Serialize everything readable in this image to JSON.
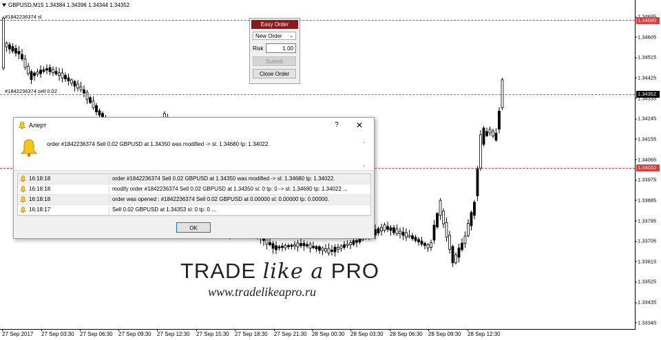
{
  "chart": {
    "symbol_header": "GBPUSD,M15  1.34384 1.34396 1.34344 1.34352",
    "order_labels": [
      {
        "text": "#1842236374 sl",
        "price": 1.3468
      },
      {
        "text": "#1842236374 sell 0.02",
        "price": 1.3435
      }
    ],
    "levels": [
      {
        "kind": "sl",
        "price": 1.3468,
        "color": "#e23a3a"
      },
      {
        "kind": "order",
        "price": 1.34352,
        "color": "#3aa83a"
      },
      {
        "kind": "tp",
        "price": 1.34022,
        "color": "#e23a3a"
      }
    ],
    "price_axis": {
      "ticks": [
        "1.34695",
        "1.34605",
        "1.34515",
        "1.34425",
        "1.34335",
        "1.34245",
        "1.34155",
        "1.34065",
        "1.33975",
        "1.33885",
        "1.33795",
        "1.33705",
        "1.33615",
        "1.33525",
        "1.33435",
        "1.33345"
      ],
      "badges": [
        {
          "label": "1.34680",
          "price": 1.3468,
          "color": "#e23a3a"
        },
        {
          "label": "1.34352",
          "price": 1.34352,
          "color": "#000000"
        },
        {
          "label": "1.34022",
          "price": 1.34022,
          "color": "#e23a3a"
        }
      ]
    },
    "time_axis": [
      "27 Sep 2017",
      "27 Sep 03:30",
      "27 Sep 06:30",
      "27 Sep 09:30",
      "27 Sep 12:30",
      "27 Sep 15:30",
      "27 Sep 18:30",
      "27 Sep 21:30",
      "28 Sep 00:30",
      "28 Sep 03:30",
      "28 Sep 06:30",
      "28 Sep 09:30",
      "28 Sep 12:30"
    ],
    "bull_color": "#ffffff",
    "bear_color": "#000000"
  },
  "easy_order": {
    "title": "Easy Order",
    "order_type": "New Order",
    "risk_label": "Risk",
    "risk_value": "1.00",
    "submit_label": "Submit",
    "close_label": "Close Order",
    "title_color": "#8b1a1a"
  },
  "alert": {
    "title": "Алерт",
    "help_symbol": "?",
    "close_symbol": "✕",
    "message": "order #1842236374 Sell 0.02 GBPUSD at 1.34350 was modified -> sl: 1.34680 tp: 1.34022.",
    "rows": [
      {
        "time": "16:18:18",
        "msg": "order #1842236374 Sell 0.02 GBPUSD at 1.34350 was modified -> sl: 1.34680 tp: 1.34022."
      },
      {
        "time": "16:18:18",
        "msg": "modify order #1842236374 Sell 0.02 GBPUSD at 1.34350 sl: 0 tp: 0 -> sl: 1.34680 tp: 1.34022 ..."
      },
      {
        "time": "16:18:18",
        "msg": "order was opened : #1842236374 Sell 0.02 GBPUSD at 0.00000 sl: 0.00000 tp: 0.00000."
      },
      {
        "time": "16:18:17",
        "msg": "Sell 0.02 GBPUSD at 1.34353 sl: 0 tp: 0 ..."
      }
    ],
    "ok_label": "OK"
  },
  "watermark": {
    "title_left": "TRADE ",
    "title_mid": "like a ",
    "title_right": "PRO",
    "url": "www.tradelikeapro.ru"
  }
}
